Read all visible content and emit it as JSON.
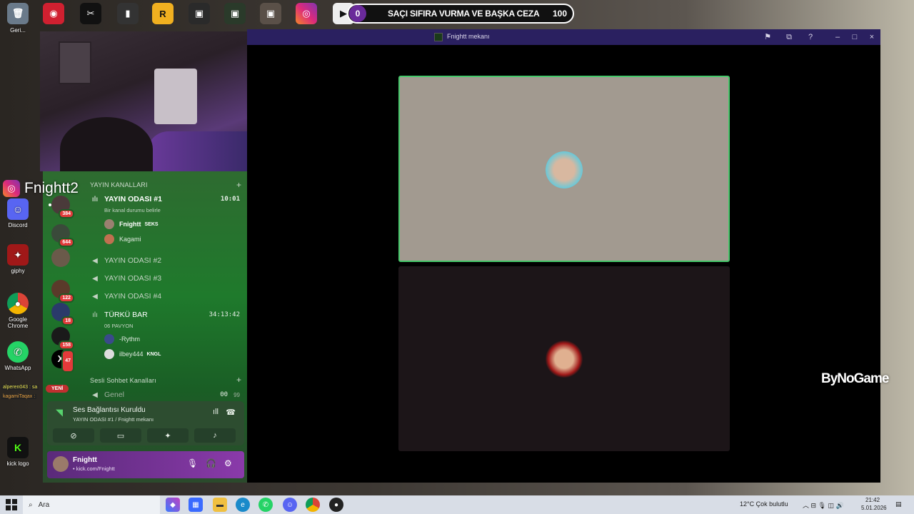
{
  "desktop": {
    "icons": [
      {
        "label": "Geri...",
        "icon": "recycle-bin-icon"
      },
      {
        "label": "Instagram",
        "icon": "instagram-icon"
      },
      {
        "label": "Discord",
        "icon": "discord-icon"
      },
      {
        "label": "giphy",
        "icon": "giphy-icon"
      },
      {
        "label": "Google Chrome",
        "icon": "chrome-icon"
      },
      {
        "label": "WhatsApp",
        "icon": "whatsapp-icon"
      },
      {
        "label": "kick logo",
        "icon": "kick-icon"
      }
    ],
    "chat_snippets": [
      "alperen043 : sa",
      "kagamiTaqax :"
    ]
  },
  "stream_overlay": {
    "banner_left_count": "0",
    "banner_title": "SAÇI SIFIRA VURMA VE BAŞKA CEZA",
    "banner_right_count": "100",
    "instagram_handle": "Fnightt2",
    "sponsor": "ByNoGame"
  },
  "discord": {
    "guild_badges": [
      "384",
      "644",
      "122",
      "18",
      "158",
      "47"
    ],
    "category_streams": "YAYIN KANALLARI",
    "category_voice": "Sesli Sohbet Kanalları",
    "channels": [
      {
        "name": "YAYIN ODASI #1",
        "time": "10:01",
        "status": "Bir kanal durumu belirle"
      },
      {
        "name": "YAYIN ODASI #2"
      },
      {
        "name": "YAYIN ODASI #3"
      },
      {
        "name": "YAYIN ODASI #4"
      },
      {
        "name": "TÜRKÜ BAR",
        "time": "34:13:42",
        "status": "06 PAVYON"
      },
      {
        "name": "Genel",
        "count_a": "00",
        "count_b": "99"
      }
    ],
    "room1_users": [
      {
        "name": "Fnightt",
        "tag": "SEKS"
      },
      {
        "name": "Kagami"
      }
    ],
    "bar_users": [
      {
        "name": "-Rythm"
      },
      {
        "name": "ilbey444",
        "tag": "KNGL"
      }
    ],
    "new_badge": "YENİ",
    "voice_panel": {
      "title": "Ses Bağlantısı Kuruldu",
      "subtitle": "YAYIN ODASI #1 / Fnightt mekanı"
    },
    "user": {
      "name": "Fnightt",
      "subtitle": "• kick.com/Fnightt"
    }
  },
  "stage_window": {
    "title": "Fnightt mekanı"
  },
  "taskbar": {
    "search_placeholder": "Ara",
    "weather": "12°C  Çok bulutlu",
    "time": "21:42",
    "date": "5.01.2026"
  }
}
